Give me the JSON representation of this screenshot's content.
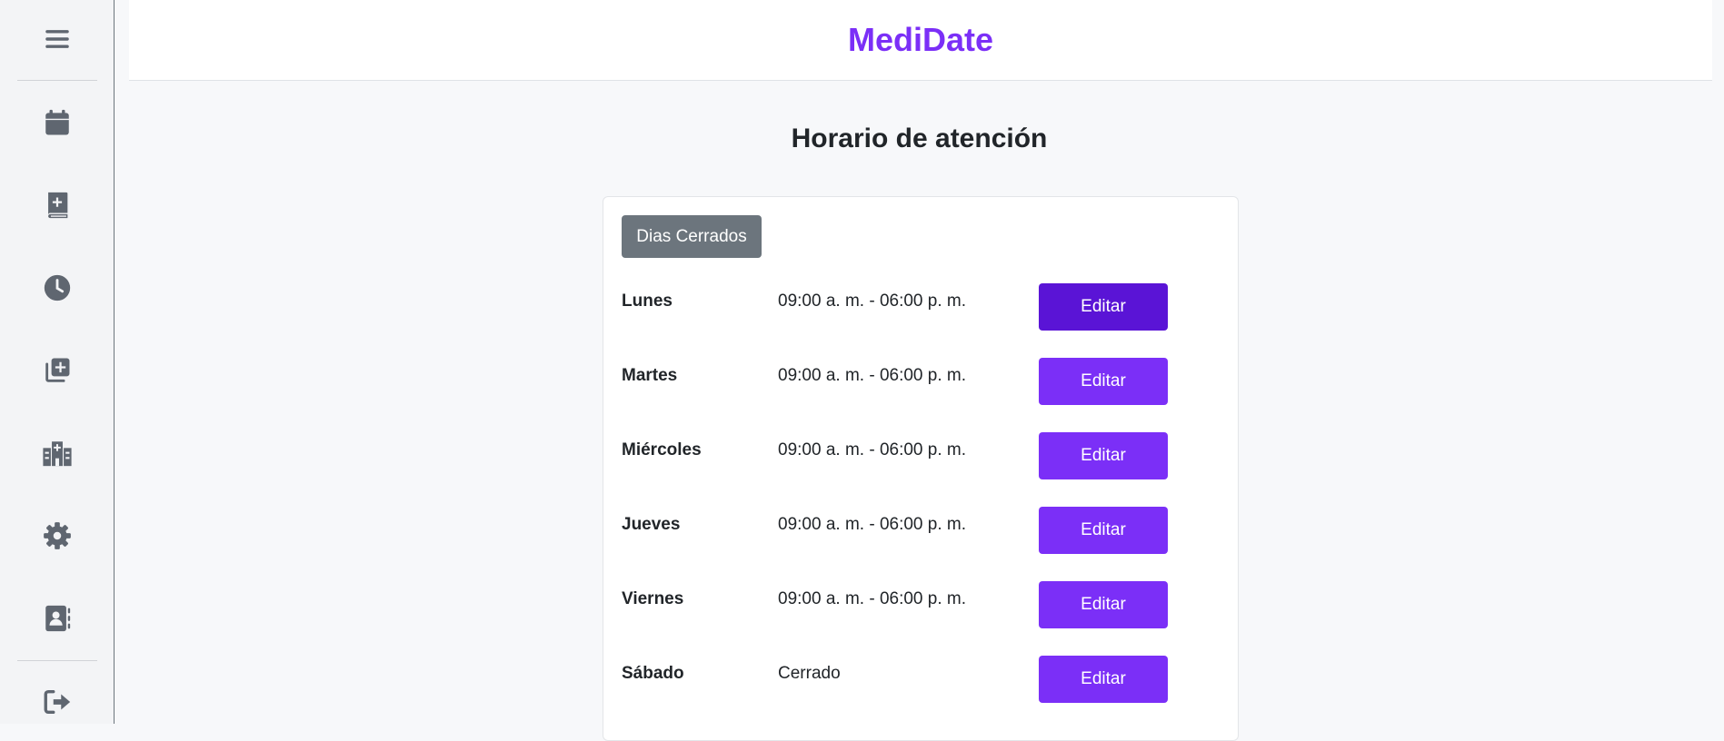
{
  "app": {
    "brand": "MediDate"
  },
  "sidebar": {
    "items": [
      {
        "name": "menu-icon"
      },
      {
        "name": "calendar-icon"
      },
      {
        "name": "medical-book-icon"
      },
      {
        "name": "clock-icon"
      },
      {
        "name": "add-records-icon"
      },
      {
        "name": "hospital-icon"
      },
      {
        "name": "gear-icon"
      },
      {
        "name": "contacts-icon"
      },
      {
        "name": "logout-icon"
      }
    ]
  },
  "main": {
    "title": "Horario de atención",
    "closed_days_label": "Dias Cerrados",
    "edit_label": "Editar",
    "schedule": [
      {
        "day": "Lunes",
        "hours": "09:00 a. m. - 06:00 p. m."
      },
      {
        "day": "Martes",
        "hours": "09:00 a. m. - 06:00 p. m."
      },
      {
        "day": "Miércoles",
        "hours": "09:00 a. m. - 06:00 p. m."
      },
      {
        "day": "Jueves",
        "hours": "09:00 a. m. - 06:00 p. m."
      },
      {
        "day": "Viernes",
        "hours": "09:00 a. m. - 06:00 p. m."
      },
      {
        "day": "Sábado",
        "hours": "Cerrado"
      }
    ]
  },
  "colors": {
    "accent": "#7b2ff7",
    "accent_active": "#5a14d6",
    "secondary": "#6c757d",
    "icon": "#5f6670"
  }
}
